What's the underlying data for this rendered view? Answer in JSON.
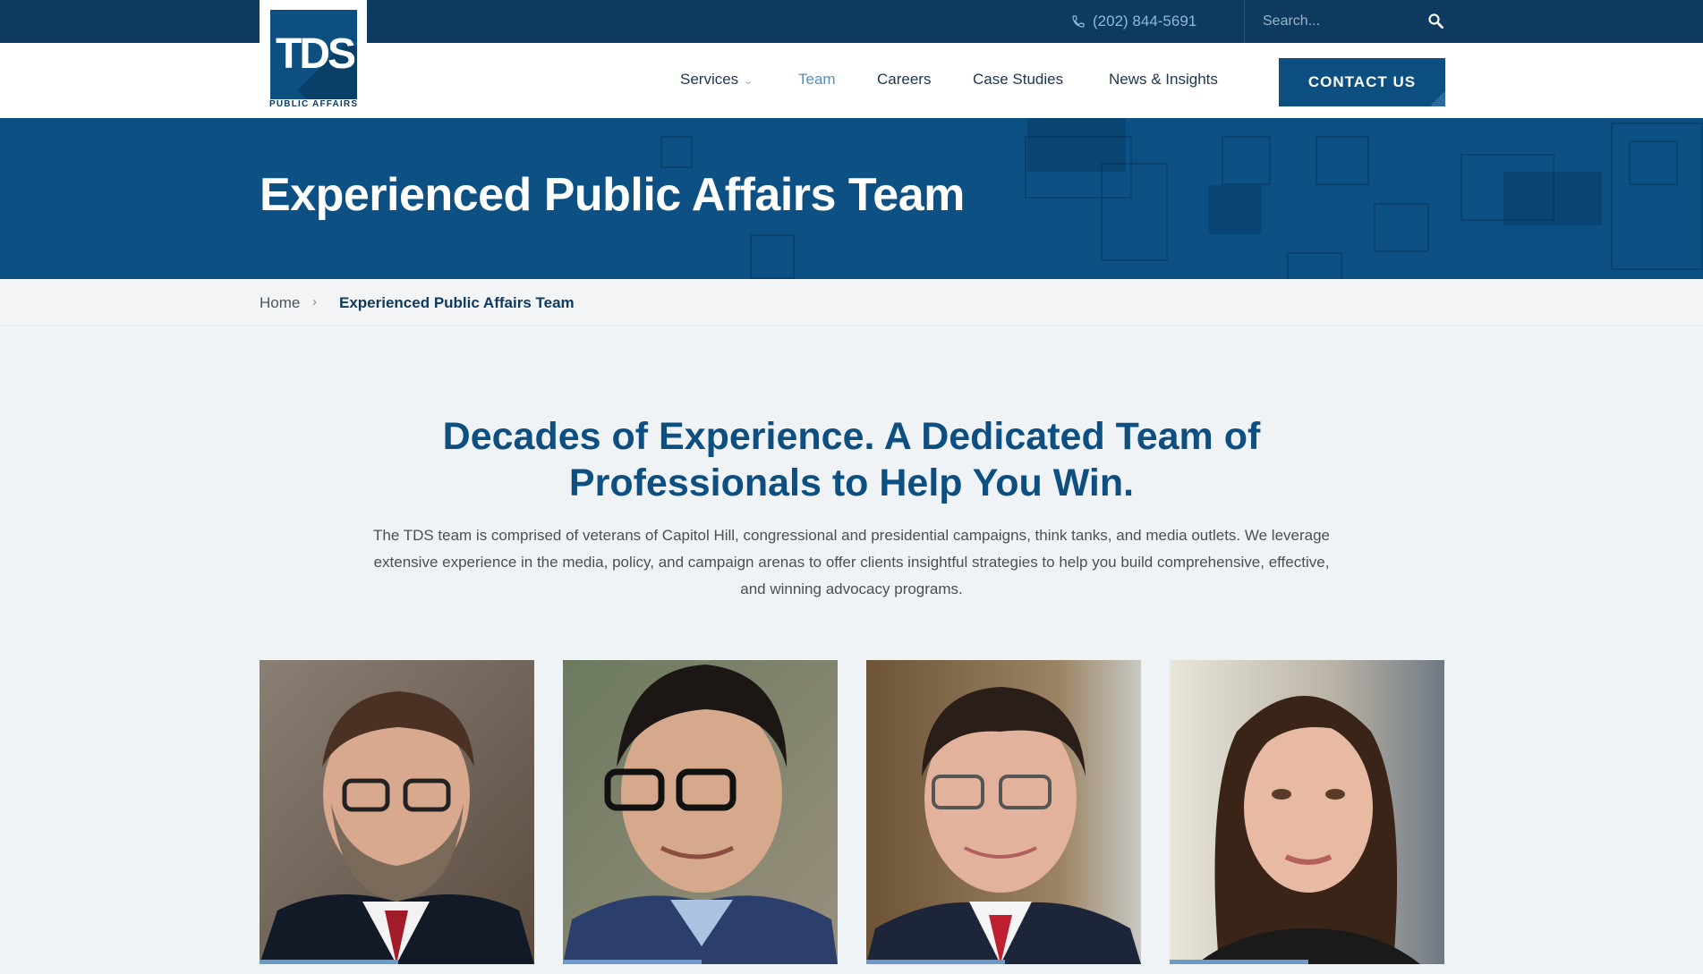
{
  "topbar": {
    "phone": "(202) 844-5691",
    "search_placeholder": "Search..."
  },
  "logo": {
    "mark": "TDS",
    "subtitle": "PUBLIC AFFAIRS"
  },
  "nav": {
    "items": [
      {
        "label": "Services"
      },
      {
        "label": "Team"
      },
      {
        "label": "Careers"
      },
      {
        "label": "Case Studies"
      },
      {
        "label": "News & Insights"
      }
    ],
    "active": "Team",
    "contact_label": "CONTACT US"
  },
  "hero": {
    "title": "Experienced Public Affairs Team"
  },
  "breadcrumb": {
    "home": "Home",
    "current": "Experienced Public Affairs Team"
  },
  "intro": {
    "title_line1": "Decades of Experience. A Dedicated Team of",
    "title_line2": "Professionals to Help You Win.",
    "body": "The TDS team is comprised of veterans of Capitol Hill, congressional and presidential campaigns, think tanks, and media outlets. We leverage extensive experience in the media, policy, and campaign arenas to offer clients insightful strategies to help you build comprehensive, effective, and winning advocacy programs."
  },
  "colors": {
    "topbar": "#0d3a5e",
    "brand": "#0d4f80",
    "accent": "#4d8fc4"
  }
}
